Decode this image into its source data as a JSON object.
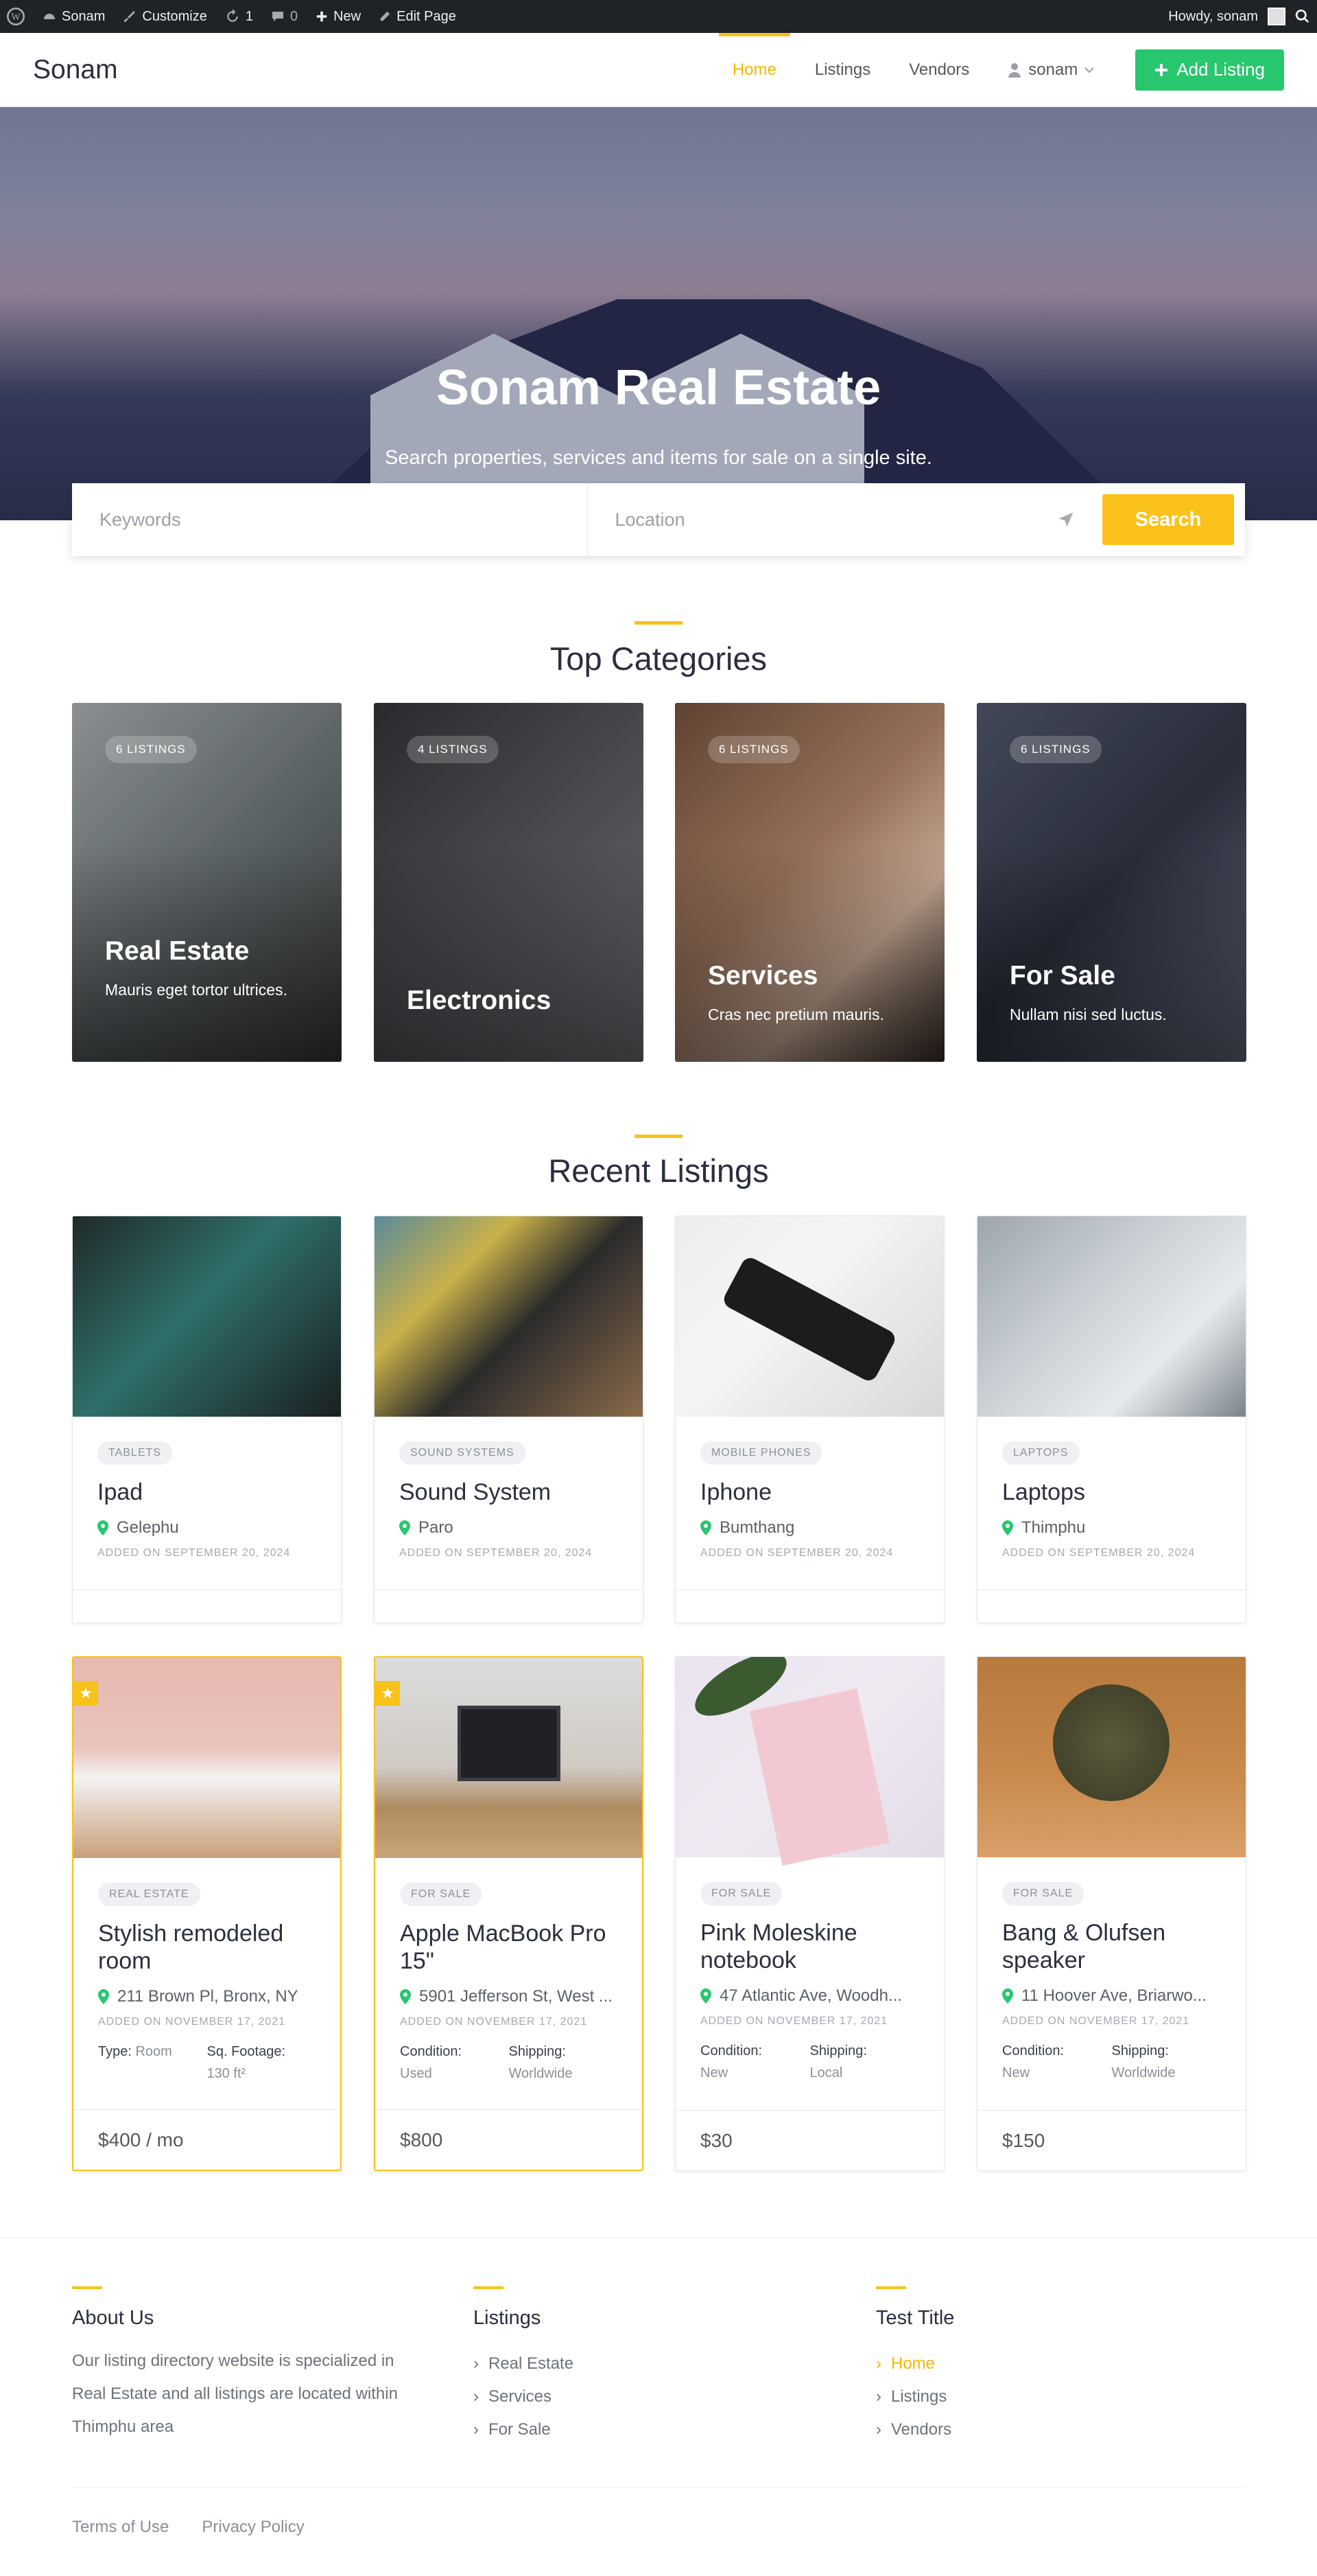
{
  "adminbar": {
    "site": "Sonam",
    "customize": "Customize",
    "updates": "1",
    "comments": "0",
    "new": "New",
    "edit_page": "Edit Page",
    "howdy": "Howdy, sonam"
  },
  "header": {
    "logo": "Sonam",
    "nav": [
      "Home",
      "Listings",
      "Vendors"
    ],
    "user": "sonam",
    "add_listing": "Add Listing"
  },
  "hero": {
    "title": "Sonam Real Estate",
    "subtitle": "Search properties, services and items for sale on a single site.",
    "keywords_placeholder": "Keywords",
    "location_placeholder": "Location",
    "search_button": "Search"
  },
  "categories": {
    "title": "Top Categories",
    "items": [
      {
        "badge": "6 LISTINGS",
        "name": "Real Estate",
        "desc": "Mauris eget tortor ultrices."
      },
      {
        "badge": "4 LISTINGS",
        "name": "Electronics",
        "desc": ""
      },
      {
        "badge": "6 LISTINGS",
        "name": "Services",
        "desc": "Cras nec pretium mauris."
      },
      {
        "badge": "6 LISTINGS",
        "name": "For Sale",
        "desc": "Nullam nisi sed luctus."
      }
    ]
  },
  "recent": {
    "title": "Recent Listings",
    "row1": [
      {
        "tag": "TABLETS",
        "title": "Ipad",
        "location": "Gelephu",
        "date": "ADDED ON SEPTEMBER 20, 2024"
      },
      {
        "tag": "SOUND SYSTEMS",
        "title": "Sound System",
        "location": "Paro",
        "date": "ADDED ON SEPTEMBER 20, 2024"
      },
      {
        "tag": "MOBILE PHONES",
        "title": "Iphone",
        "location": "Bumthang",
        "date": "ADDED ON SEPTEMBER 20, 2024"
      },
      {
        "tag": "LAPTOPS",
        "title": "Laptops",
        "location": "Thimphu",
        "date": "ADDED ON SEPTEMBER 20, 2024"
      }
    ],
    "row2": [
      {
        "tag": "REAL ESTATE",
        "title": "Stylish remodeled room",
        "location": "211 Brown Pl, Bronx, NY",
        "date": "ADDED ON NOVEMBER 17, 2021",
        "a1_label": "Type:",
        "a1_value": "Room",
        "a2_label": "Sq. Footage:",
        "a2_value": "130 ft²",
        "price": "$400 / mo"
      },
      {
        "tag": "FOR SALE",
        "title": "Apple MacBook Pro 15\"",
        "location": "5901 Jefferson St, West ...",
        "date": "ADDED ON NOVEMBER 17, 2021",
        "a1_label": "Condition:",
        "a1_value": "Used",
        "a2_label": "Shipping:",
        "a2_value": "Worldwide",
        "price": "$800"
      },
      {
        "tag": "FOR SALE",
        "title": "Pink Moleskine notebook",
        "location": "47 Atlantic Ave, Woodh...",
        "date": "ADDED ON NOVEMBER 17, 2021",
        "a1_label": "Condition:",
        "a1_value": "New",
        "a2_label": "Shipping:",
        "a2_value": "Local",
        "price": "$30"
      },
      {
        "tag": "FOR SALE",
        "title": "Bang & Olufsen speaker",
        "location": "11 Hoover Ave, Briarwo...",
        "date": "ADDED ON NOVEMBER 17, 2021",
        "a1_label": "Condition:",
        "a1_value": "New",
        "a2_label": "Shipping:",
        "a2_value": "Worldwide",
        "price": "$150"
      }
    ]
  },
  "footer": {
    "about_title": "About Us",
    "about_text": "Our listing directory website is specialized in Real Estate and all listings are located within Thimphu area",
    "listings_title": "Listings",
    "listings_links": [
      "Real Estate",
      "Services",
      "For Sale"
    ],
    "test_title": "Test Title",
    "test_links": [
      "Home",
      "Listings",
      "Vendors"
    ],
    "terms": "Terms of Use",
    "privacy": "Privacy Policy"
  },
  "colors": {
    "accent": "#f7c21a",
    "green": "#28c76f",
    "adminbar": "#1d2327"
  }
}
